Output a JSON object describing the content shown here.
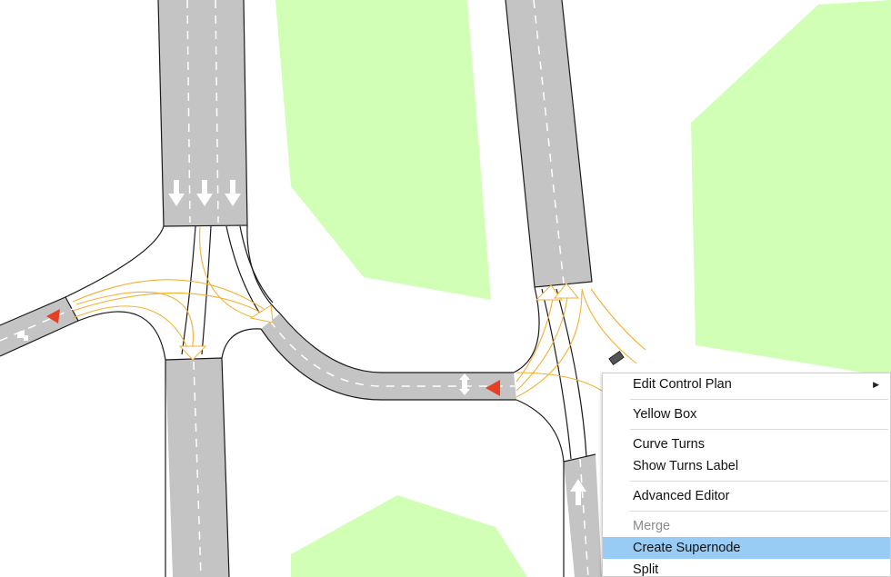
{
  "colors": {
    "road": "#c4c4c4",
    "road_edge": "#1a1a1a",
    "lane_marking": "#ffffff",
    "green_area": "#d1ffb6",
    "turn_path": "#f2b134",
    "signal_red": "#e64024",
    "detector": "#555555",
    "menu_highlight": "#99ccf5"
  },
  "map": {
    "lane_arrows": [
      "arrow-down-icon",
      "arrow-down-icon",
      "arrow-down-icon",
      "arrow-up-icon",
      "arrow-up-down-icon",
      "arrow-turn-icon"
    ],
    "signal_heads": [
      "signal-triangle-icon",
      "signal-triangle-icon"
    ]
  },
  "context_menu": {
    "items": [
      {
        "label": "Edit Control Plan",
        "has_submenu": true,
        "disabled": false,
        "highlighted": false
      },
      {
        "separator": true
      },
      {
        "label": "Yellow Box",
        "disabled": false,
        "highlighted": false
      },
      {
        "separator": true
      },
      {
        "label": "Curve Turns",
        "disabled": false,
        "highlighted": false
      },
      {
        "label": "Show Turns Label",
        "disabled": false,
        "highlighted": false
      },
      {
        "separator": true
      },
      {
        "label": "Advanced Editor",
        "disabled": false,
        "highlighted": false
      },
      {
        "separator": true
      },
      {
        "label": "Merge",
        "disabled": true,
        "highlighted": false
      },
      {
        "label": "Create Supernode",
        "disabled": false,
        "highlighted": true
      },
      {
        "label": "Split",
        "disabled": false,
        "highlighted": false
      }
    ],
    "submenu_arrow_icon": "chevron-right-icon"
  }
}
